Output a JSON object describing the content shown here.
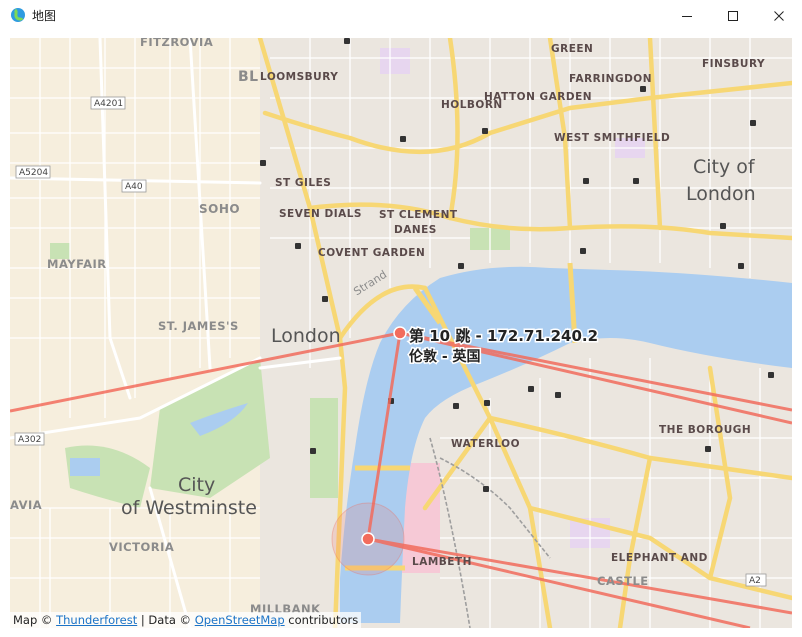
{
  "window": {
    "title": "地图",
    "icons": {
      "app": "map-app-icon",
      "minimize": "minimize-icon",
      "maximize": "maximize-icon",
      "close": "close-icon"
    }
  },
  "colors": {
    "water": "#abcdf0",
    "park": "#c8e2b4",
    "land": "#f4efe6",
    "road_major": "#f7d774",
    "route": "#f26c5d",
    "marker": "#f26c5d",
    "urban": "#e6e1da"
  },
  "map": {
    "labels": {
      "fitzrovia": "FITZROVIA",
      "bloomsbury": "LOOMSBURY",
      "bl": "BL",
      "green": "GREEN",
      "finsbury": "FINSBURY",
      "farringdon": "FARRINGDON",
      "hatton_garden": "HATTON GARDEN",
      "holborn": "HOLBORN",
      "west_smithfield": "WEST SMITHFIELD",
      "city_of_london_1": "City of",
      "city_of_london_2": "London",
      "st_giles": "ST GILES",
      "soho": "SOHO",
      "seven_dials": "SEVEN DIALS",
      "st_clement_1": "ST CLEMENT",
      "st_clement_2": "DANES",
      "covent_garden": "COVENT GARDEN",
      "strand": "Strand",
      "mayfair": "MAYFAIR",
      "st_james": "ST. JAMES'S",
      "london": "London",
      "the_borough": "THE BOROUGH",
      "waterloo": "WATERLOO",
      "city_westminster_1": "City",
      "city_westminster_2": "of Westminste",
      "avia": "AVIA",
      "victoria": "VICTORIA",
      "lambeth": "LAMBETH",
      "elephant_1": "ELEPHANT AND",
      "elephant_2": "CASTLE",
      "millbank": "MILLBANK"
    },
    "road_badges": {
      "a4201": "A4201",
      "a5204": "A5204",
      "a40": "A40",
      "a302": "A302",
      "a2": "A2"
    },
    "hop": {
      "line1": "第 10 跳 - 172.71.240.2",
      "line2": "伦敦 - 英国"
    },
    "attribution": {
      "prefix": "Map © ",
      "thunderforest": "Thunderforest",
      "middle": " | Data © ",
      "osm": "OpenStreetMap",
      "suffix": " contributors"
    }
  }
}
